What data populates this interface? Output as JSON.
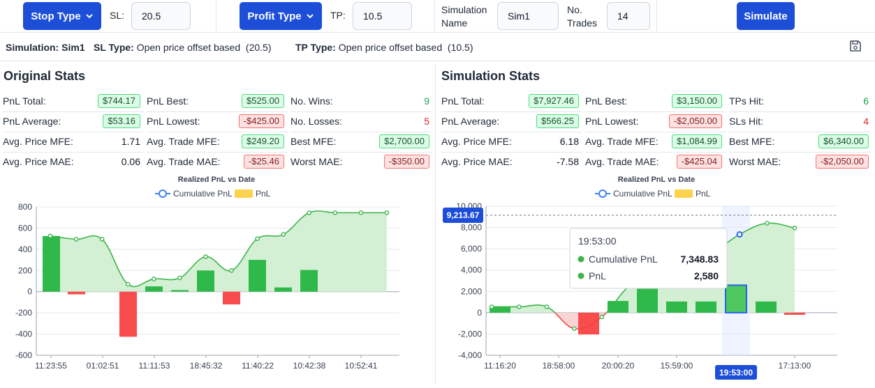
{
  "controls": {
    "stop_type_label": "Stop Type",
    "sl_label": "SL:",
    "sl_value": "20.5",
    "profit_type_label": "Profit Type",
    "tp_label": "TP:",
    "tp_value": "10.5",
    "sim_name_label_1": "Simulation",
    "sim_name_label_2": "Name",
    "sim_name_value": "Sim1",
    "trades_label_1": "No.",
    "trades_label_2": "Trades",
    "trades_value": "14",
    "simulate_label": "Simulate"
  },
  "info": {
    "sim_key": "Simulation:",
    "sim_val": "Sim1",
    "sl_key": "SL Type:",
    "sl_val": "Open price offset based",
    "sl_num": "(20.5)",
    "tp_key": "TP Type:",
    "tp_val": "Open price offset based",
    "tp_num": "(10.5)",
    "save_icon": "save-icon"
  },
  "original": {
    "title": "Original Stats",
    "stats": [
      {
        "label": "PnL Total:",
        "value": "$744.17",
        "kind": "pos"
      },
      {
        "label": "PnL Average:",
        "value": "$53.16",
        "kind": "pos"
      },
      {
        "label": "Avg. Price MFE:",
        "value": "1.71",
        "kind": "plain"
      },
      {
        "label": "Avg. Price MAE:",
        "value": "0.06",
        "kind": "plain"
      },
      {
        "label": "PnL Best:",
        "value": "$525.00",
        "kind": "pos"
      },
      {
        "label": "PnL Lowest:",
        "value": "-$425.00",
        "kind": "neg"
      },
      {
        "label": "Avg. Trade MFE:",
        "value": "$249.20",
        "kind": "pos"
      },
      {
        "label": "Avg. Trade MAE:",
        "value": "-$25.46",
        "kind": "neg"
      },
      {
        "label": "No. Wins:",
        "value": "9",
        "kind": "green"
      },
      {
        "label": "No. Losses:",
        "value": "5",
        "kind": "red"
      },
      {
        "label": "Best MFE:",
        "value": "$2,700.00",
        "kind": "pos"
      },
      {
        "label": "Worst MAE:",
        "value": "-$350.00",
        "kind": "neg"
      }
    ]
  },
  "simulation": {
    "title": "Simulation Stats",
    "stats": [
      {
        "label": "PnL Total:",
        "value": "$7,927.46",
        "kind": "pos"
      },
      {
        "label": "PnL Average:",
        "value": "$566.25",
        "kind": "pos"
      },
      {
        "label": "Avg. Price MFE:",
        "value": "6.18",
        "kind": "plain"
      },
      {
        "label": "Avg. Price MAE:",
        "value": "-7.58",
        "kind": "plain"
      },
      {
        "label": "PnL Best:",
        "value": "$3,150.00",
        "kind": "pos"
      },
      {
        "label": "PnL Lowest:",
        "value": "-$2,050.00",
        "kind": "neg"
      },
      {
        "label": "Avg. Trade MFE:",
        "value": "$1,084.99",
        "kind": "pos"
      },
      {
        "label": "Avg. Trade MAE:",
        "value": "-$425.04",
        "kind": "neg"
      },
      {
        "label": "TPs Hit:",
        "value": "6",
        "kind": "green"
      },
      {
        "label": "SLs Hit:",
        "value": "4",
        "kind": "red"
      },
      {
        "label": "Best MFE:",
        "value": "$6,340.00",
        "kind": "pos"
      },
      {
        "label": "Worst MAE:",
        "value": "-$2,050.00",
        "kind": "neg"
      }
    ]
  },
  "colors": {
    "accent": "#1d4ed8",
    "bar_pos": "#2fb94a",
    "bar_neg": "#f94c4c",
    "line": "#3cb44b",
    "area_pos": "#d4f0d4",
    "area_neg": "#fbd5d5",
    "marker": "#2563eb"
  },
  "chart_data": [
    {
      "type": "bar",
      "title": "Realized PnL vs Date",
      "legend": [
        "Cumulative PnL",
        "PnL"
      ],
      "legend_position": "top",
      "x_tick_labels": [
        "11:23:55",
        "01:02:51",
        "11:11:53",
        "18:45:32",
        "11:40:22",
        "10:42:38",
        "10:52:41"
      ],
      "y_ticks": [
        "800",
        "600",
        "400",
        "200",
        "0",
        "-200",
        "-400",
        "-600"
      ],
      "ylim": [
        -600,
        800
      ],
      "grid": true,
      "series": [
        {
          "name": "PnL",
          "type": "bar",
          "values": [
            525,
            -25,
            -425,
            50,
            15,
            200,
            -120,
            300,
            40,
            205
          ]
        },
        {
          "name": "Cumulative PnL",
          "type": "line",
          "values": [
            525,
            495,
            495,
            70,
            120,
            130,
            330,
            200,
            500,
            540,
            745,
            745,
            745,
            745
          ]
        }
      ]
    },
    {
      "type": "bar",
      "title": "Realized PnL vs Date",
      "legend": [
        "Cumulative PnL",
        "PnL"
      ],
      "legend_position": "top",
      "x_tick_labels": [
        "11:16:20",
        "18:58:00",
        "20:00:20",
        "15:59:00",
        "19:53:00",
        "17:13:00"
      ],
      "y_ticks": [
        "10,000",
        "8,000",
        "6,000",
        "4,000",
        "2,000",
        "0",
        "-2,000",
        "-4,000"
      ],
      "ylim": [
        -4000,
        10000
      ],
      "grid": true,
      "crosshair_y_label": "9,213.67",
      "crosshair_x_label": "19:53:00",
      "tooltip": {
        "title": "19:53:00",
        "rows": [
          {
            "label": "Cumulative PnL",
            "value": "7,348.83"
          },
          {
            "label": "PnL",
            "value": "2,580"
          }
        ]
      },
      "series": [
        {
          "name": "PnL",
          "type": "bar",
          "values": [
            550,
            -2050,
            1100,
            2900,
            1050,
            1050,
            2580,
            1050,
            -200
          ]
        },
        {
          "name": "Cumulative PnL",
          "type": "line",
          "values": [
            550,
            550,
            550,
            -1500,
            -400,
            2500,
            3500,
            4600,
            5600,
            7349,
            8400,
            7950
          ]
        }
      ]
    }
  ]
}
